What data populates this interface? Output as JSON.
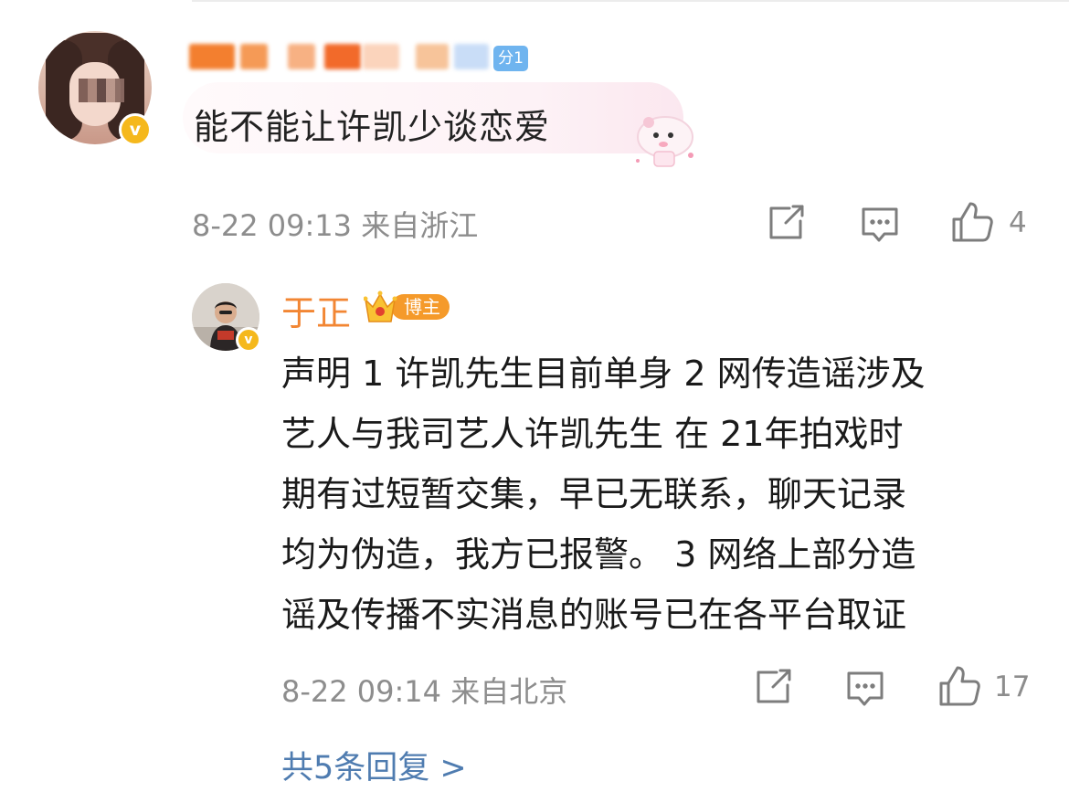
{
  "main_comment": {
    "level_badge": "分1",
    "verified_mark": "v",
    "text": "能不能让许凯少谈恋爱",
    "time": "8-22 09:13",
    "location": "来自浙江",
    "like_count": "4"
  },
  "reply": {
    "author": "于正",
    "role_badge": "博主",
    "verified_mark": "v",
    "lines": [
      "声明 1 许凯先生目前单身 2 网传造谣涉及",
      "艺人与我司艺人许凯先生 在 21年拍戏时",
      "期有过短暂交集，早已无联系，聊天记录",
      "均为伪造，我方已报警。 3 网络上部分造",
      "谣及传播不实消息的账号已在各平台取证"
    ],
    "time": "8-22 09:14",
    "location": "来自北京",
    "like_count": "17"
  },
  "more_replies": "共5条回复 >",
  "icons": [
    "share-icon",
    "comment-icon",
    "like-icon"
  ],
  "colors": {
    "author_orange": "#f28633",
    "link_blue": "#4f7cb0",
    "meta_gray": "#8d8d8d",
    "verified_gold": "#f5b81c"
  }
}
